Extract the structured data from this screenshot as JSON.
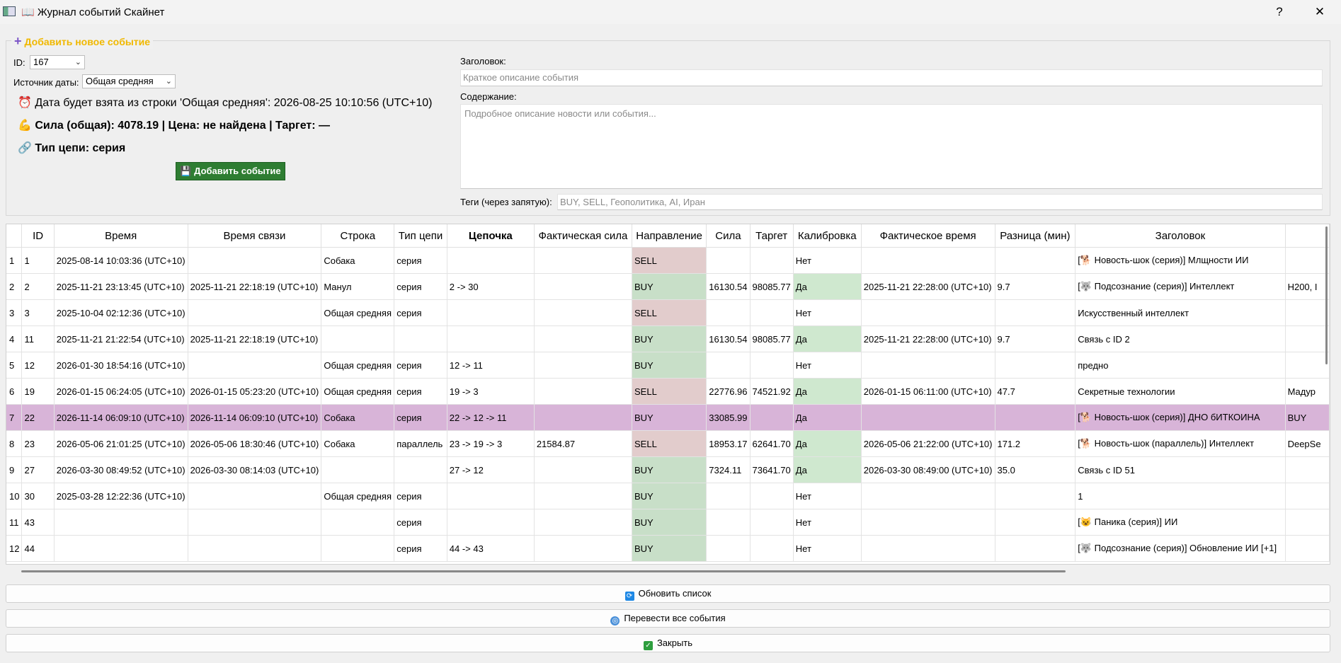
{
  "window": {
    "title": "📖 Журнал событий Скайнет",
    "help_label": "?",
    "close_label": "✕"
  },
  "form": {
    "group_title": "Добавить новое событие",
    "id_label": "ID:",
    "id_value": "167",
    "date_source_label": "Источник даты:",
    "date_source_value": "Общая средняя",
    "date_info": "⏰ Дата будет взята из строки 'Общая средняя': 2026-08-25 10:10:56 (UTC+10)",
    "power_info": "💪 Сила (общая): 4078.19 | Цена: не найдена | Таргет: —",
    "chain_info": "🔗 Тип цепи: серия",
    "add_button": "💾 Добавить событие",
    "headline_label": "Заголовок:",
    "headline_placeholder": "Краткое описание события",
    "content_label": "Содержание:",
    "content_placeholder": "Подробное описание новости или события...",
    "tags_label": "Теги (через запятую):",
    "tags_placeholder": "BUY, SELL, Геополитика, AI, Иран"
  },
  "table": {
    "columns": [
      "",
      "ID",
      "Время",
      "Время связи",
      "Строка",
      "Тип цепи",
      "Цепочка",
      "Фактическая сила",
      "Направление",
      "Сила",
      "Таргет",
      "Калибровка",
      "Фактическое время",
      "Разница (мин)",
      "Заголовок",
      ""
    ],
    "rows": [
      [
        "1",
        "1",
        "2025-08-14 10:03:36 (UTC+10)",
        "",
        "Собака",
        "серия",
        "",
        "",
        "SELL",
        "",
        "",
        "Нет",
        "",
        "",
        "[🐕 Новость-шок (серия)] Млщности ИИ",
        ""
      ],
      [
        "2",
        "2",
        "2025-11-21 23:13:45 (UTC+10)",
        "2025-11-21 22:18:19 (UTC+10)",
        "Манул",
        "серия",
        "2 -> 30",
        "",
        "BUY",
        "16130.54",
        "98085.77",
        "Да",
        "2025-11-21 22:28:00 (UTC+10)",
        "9.7",
        "[🐺 Подсознание (серия)] Интеллект",
        "H200, I"
      ],
      [
        "3",
        "3",
        "2025-10-04 02:12:36 (UTC+10)",
        "",
        "Общая средняя",
        "серия",
        "",
        "",
        "SELL",
        "",
        "",
        "Нет",
        "",
        "",
        "Искусственный интеллект",
        ""
      ],
      [
        "4",
        "11",
        "2025-11-21 21:22:54 (UTC+10)",
        "2025-11-21 22:18:19 (UTC+10)",
        "",
        "",
        "",
        "",
        "BUY",
        "16130.54",
        "98085.77",
        "Да",
        "2025-11-21 22:28:00 (UTC+10)",
        "9.7",
        "Связь с ID 2",
        ""
      ],
      [
        "5",
        "12",
        "2026-01-30 18:54:16 (UTC+10)",
        "",
        "Общая средняя",
        "серия",
        "12 -> 11",
        "",
        "BUY",
        "",
        "",
        "Нет",
        "",
        "",
        "преднo",
        ""
      ],
      [
        "6",
        "19",
        "2026-01-15 06:24:05 (UTC+10)",
        "2026-01-15 05:23:20 (UTC+10)",
        "Общая средняя",
        "серия",
        "19 -> 3",
        "",
        "SELL",
        "22776.96",
        "74521.92",
        "Да",
        "2026-01-15 06:11:00 (UTC+10)",
        "47.7",
        "Секретные технологии",
        "Мадур"
      ],
      [
        "7",
        "22",
        "2026-11-14 06:09:10 (UTC+10)",
        "2026-11-14 06:09:10 (UTC+10)",
        "Собака",
        "серия",
        "22 -> 12 -> 11",
        "",
        "BUY",
        "33085.99",
        "",
        "Да",
        "",
        "",
        "[🐕 Новость-шок (серия)] ДНО бИТКОИНА",
        "BUY"
      ],
      [
        "8",
        "23",
        "2026-05-06 21:01:25 (UTC+10)",
        "2026-05-06 18:30:46 (UTC+10)",
        "Собака",
        "параллель",
        "23 -> 19 -> 3",
        "21584.87",
        "SELL",
        "18953.17",
        "62641.70",
        "Да",
        "2026-05-06 21:22:00 (UTC+10)",
        "171.2",
        "[🐕 Новость-шок (параллель)] Интеллект",
        "DeepSe"
      ],
      [
        "9",
        "27",
        "2026-03-30 08:49:52 (UTC+10)",
        "2026-03-30 08:14:03 (UTC+10)",
        "",
        "",
        "27 -> 12",
        "",
        "BUY",
        "7324.11",
        "73641.70",
        "Да",
        "2026-03-30 08:49:00 (UTC+10)",
        "35.0",
        "Связь с ID 51",
        ""
      ],
      [
        "10",
        "30",
        "2025-03-28 12:22:36 (UTC+10)",
        "",
        "Общая средняя",
        "серия",
        "",
        "",
        "BUY",
        "",
        "",
        "Нет",
        "",
        "",
        "1",
        ""
      ],
      [
        "11",
        "43",
        "",
        "",
        "",
        "серия",
        "",
        "",
        "BUY",
        "",
        "",
        "Нет",
        "",
        "",
        "[😺 Паника (серия)] ИИ",
        ""
      ],
      [
        "12",
        "44",
        "",
        "",
        "",
        "серия",
        "44 -> 43",
        "",
        "BUY",
        "",
        "",
        "Нет",
        "",
        "",
        "[🐺 Подсознание (серия)] Обновление ИИ [+1]",
        ""
      ]
    ],
    "selected_row": 6
  },
  "buttons": {
    "refresh": "Обновить список",
    "translate": "Перевести все события",
    "close": "Закрыть"
  },
  "colors": {
    "buy": "#c8dfc8",
    "sell": "#e2cccc",
    "selected": "#d8b4d8",
    "add_button": "#2e7d32",
    "group_title": "#f0b800"
  }
}
